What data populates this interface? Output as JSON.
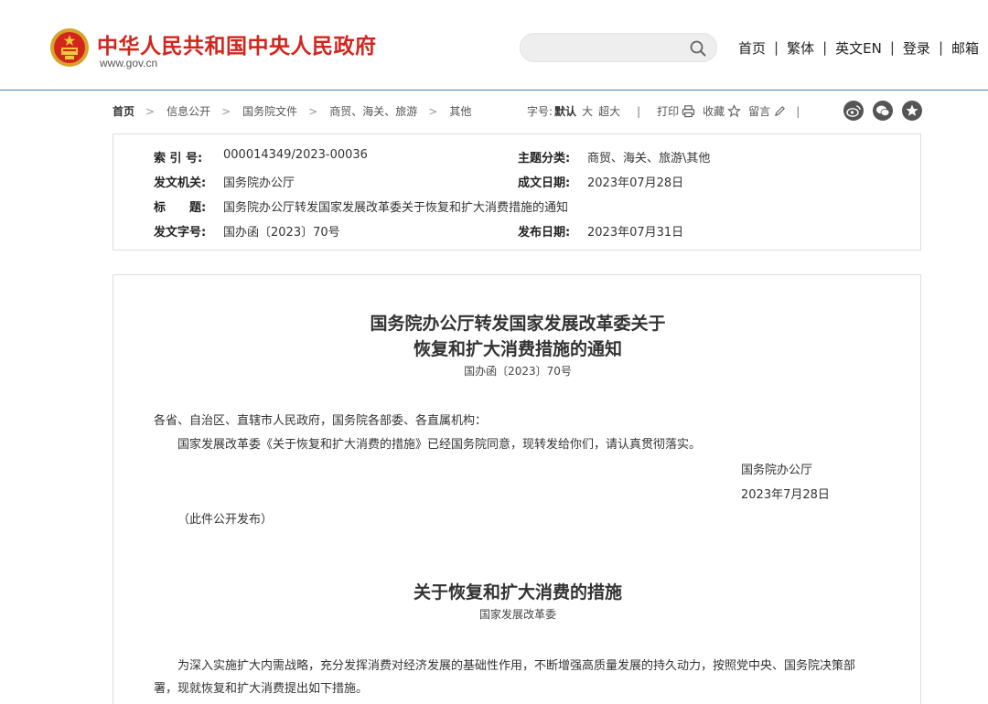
{
  "header": {
    "site_name": "中华人民共和国中央人民政府",
    "site_url": "www.gov.cn",
    "search_placeholder": "",
    "nav": [
      "首页",
      "繁体",
      "英文EN",
      "登录",
      "邮箱"
    ],
    "nav_separator": "|"
  },
  "breadcrumb": {
    "items": [
      "首页",
      "信息公开",
      "国务院文件",
      "商贸、海关、旅游",
      "其他"
    ],
    "separator": ">"
  },
  "toolbar": {
    "font_size_label": "字号:",
    "font_default": "默认",
    "font_large": "大",
    "font_xlarge": "超大",
    "print_label": "打印",
    "favorite_label": "收藏",
    "comment_label": "留言",
    "separator": "|"
  },
  "info": {
    "index_label": "索 引 号:",
    "index_value": "000014349/2023-00036",
    "topic_label": "主题分类:",
    "topic_value": "商贸、海关、旅游\\其他",
    "issuer_label": "发文机关:",
    "issuer_value": "国务院办公厅",
    "written_label": "成文日期:",
    "written_value": "2023年07月28日",
    "title_label": "标　　题:",
    "title_value": "国务院办公厅转发国家发展改革委关于恢复和扩大消费措施的通知",
    "docno_label": "发文字号:",
    "docno_value": "国办函〔2023〕70号",
    "published_label": "发布日期:",
    "published_value": "2023年07月31日"
  },
  "document": {
    "title_line1": "国务院办公厅转发国家发展改革委关于",
    "title_line2": "恢复和扩大消费措施的通知",
    "doc_number": "国办函〔2023〕70号",
    "salutation": "各省、自治区、直辖市人民政府，国务院各部委、各直属机构：",
    "body": "国家发展改革委《关于恢复和扩大消费的措施》已经国务院同意，现转发给你们，请认真贯彻落实。",
    "signer": "国务院办公厅",
    "sign_date": "2023年7月28日",
    "public_note": "（此件公开发布）",
    "sub_title": "关于恢复和扩大消费的措施",
    "sub_author": "国家发展改革委",
    "para_line1": "为深入实施扩大内需战略，充分发挥消费对经济发展的基础性作用，不断增强高质量发展的持久动力，按照党中央、国务院决策部",
    "para_line2": "署，现就恢复和扩大消费提出如下措施。"
  },
  "colors": {
    "brand_red": "#d2261c",
    "header_rule": "#4e7fb8"
  }
}
